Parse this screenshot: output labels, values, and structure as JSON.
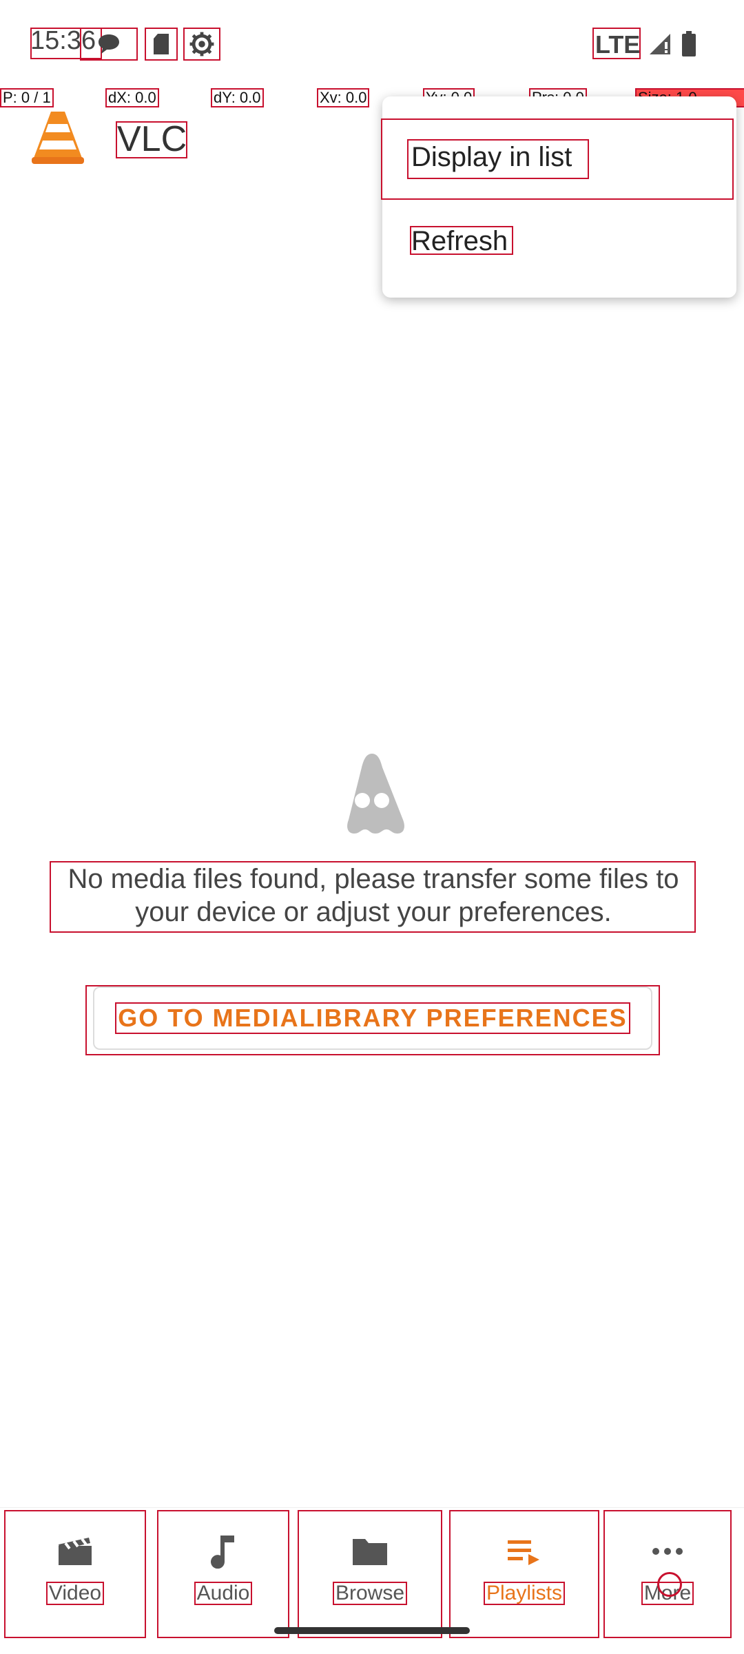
{
  "status_bar": {
    "time": "15:36",
    "network": "LTE",
    "icons": [
      "chat-bubble-icon",
      "sd-card-icon",
      "settings-gear-icon",
      "signal-icon",
      "battery-icon"
    ]
  },
  "pointer_overlay": {
    "p": "P: 0 / 1",
    "dx": "dX: 0.0",
    "dy": "dY: 0.0",
    "xv": "Xv: 0.0",
    "yv": "Yv: 0.0",
    "prs": "Prs: 0.0",
    "size": "Size: 1.0"
  },
  "app_bar": {
    "title": "VLC",
    "logo": "vlc-cone-icon"
  },
  "menu": {
    "items": [
      {
        "label": "Display in list"
      },
      {
        "label": "Refresh"
      }
    ]
  },
  "empty_state": {
    "icon": "ghost-cone-icon",
    "message": "No media files found, please transfer some files to your device or adjust your preferences.",
    "button": "GO TO MEDIALIBRARY PREFERENCES"
  },
  "bottom_nav": {
    "items": [
      {
        "label": "Video",
        "icon": "clapperboard-icon"
      },
      {
        "label": "Audio",
        "icon": "music-note-icon"
      },
      {
        "label": "Browse",
        "icon": "folder-icon"
      },
      {
        "label": "Playlists",
        "icon": "playlist-icon",
        "active": true
      },
      {
        "label": "More",
        "icon": "more-dots-icon"
      }
    ]
  },
  "colors": {
    "accent": "#e8741a",
    "annotation": "#c8102e"
  }
}
